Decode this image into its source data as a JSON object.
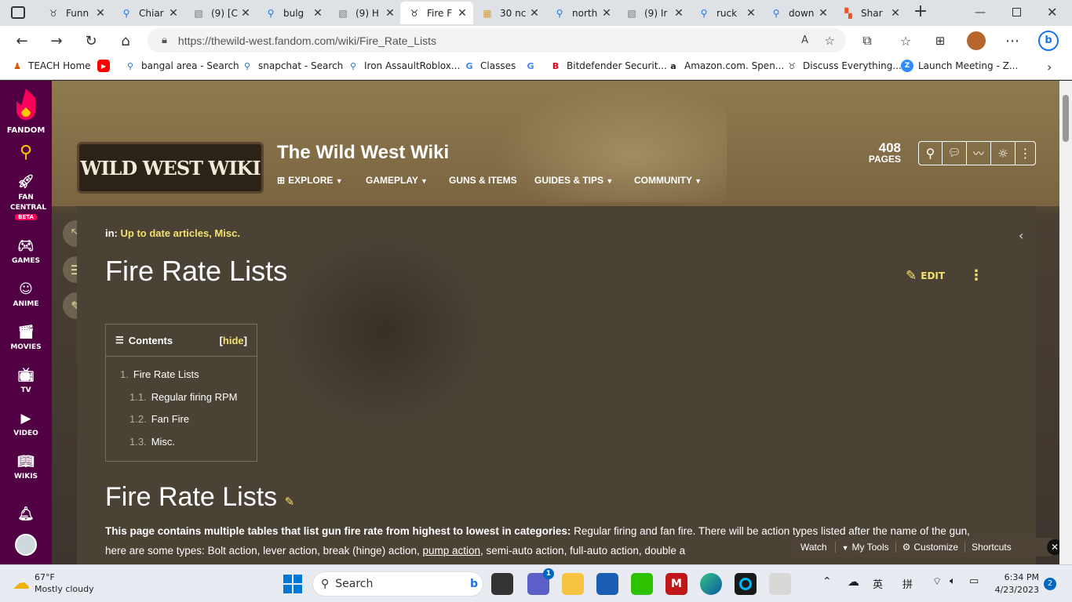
{
  "tabs": [
    {
      "title": "Funn",
      "icon": "bull-icon"
    },
    {
      "title": "Chiar",
      "icon": "search-icon"
    },
    {
      "title": "(9) [C",
      "icon": "roblox-icon"
    },
    {
      "title": "bulg",
      "icon": "search-icon"
    },
    {
      "title": "(9) H",
      "icon": "roblox-icon"
    },
    {
      "title": "Fire F",
      "icon": "bull-icon"
    },
    {
      "title": "30 nc",
      "icon": "tiles-icon"
    },
    {
      "title": "north",
      "icon": "search-icon"
    },
    {
      "title": "(9) Ir",
      "icon": "roblox-icon"
    },
    {
      "title": "ruck",
      "icon": "search-icon"
    },
    {
      "title": "down",
      "icon": "search-icon"
    },
    {
      "title": "Shar",
      "icon": "microsoft-icon"
    }
  ],
  "address": {
    "url": "https://thewild-west.fandom.com/wiki/Fire_Rate_Lists"
  },
  "bookmarks": [
    {
      "label": "TEACH Home",
      "icon": "teach-icon"
    },
    {
      "label": "",
      "icon": "youtube-icon"
    },
    {
      "label": "bangal area - Search",
      "icon": "search-icon"
    },
    {
      "label": "snapchat - Search",
      "icon": "search-icon"
    },
    {
      "label": "Iron AssaultRoblox...",
      "icon": "search-icon"
    },
    {
      "label": "Classes",
      "icon": "google-icon"
    },
    {
      "label": "",
      "icon": "google-icon"
    },
    {
      "label": "Bitdefender Securit...",
      "icon": "bitdefender-icon"
    },
    {
      "label": "Amazon.com. Spen...",
      "icon": "amazon-icon"
    },
    {
      "label": "Discuss Everything...",
      "icon": "bull-icon"
    },
    {
      "label": "Launch Meeting - Z...",
      "icon": "zoom-icon"
    }
  ],
  "rail": {
    "brand": "FANDOM",
    "fan_central": "FAN CENTRAL",
    "beta": "BETA",
    "games": "GAMES",
    "anime": "ANIME",
    "movies": "MOVIES",
    "tv": "TV",
    "video": "VIDEO",
    "wikis": "WIKIS"
  },
  "wiki": {
    "logo_text": "WILD WEST WIKI",
    "title": "The Wild West Wiki",
    "page_count": "408",
    "pages_label": "PAGES",
    "nav": [
      "EXPLORE",
      "GAMEPLAY",
      "GUNS & ITEMS",
      "GUIDES & TIPS",
      "COMMUNITY"
    ]
  },
  "article": {
    "categories_label": "in:",
    "categories": "Up to date articles, Misc.",
    "title": "Fire Rate Lists",
    "edit_label": "EDIT",
    "toc_title": "Contents",
    "toc_hide": "hide",
    "toc": [
      {
        "num": "1.",
        "label": "Fire Rate Lists"
      },
      {
        "num": "1.1.",
        "label": "Regular firing RPM"
      },
      {
        "num": "1.2.",
        "label": "Fan Fire"
      },
      {
        "num": "1.3.",
        "label": "Misc."
      }
    ],
    "section_title": "Fire Rate Lists",
    "body_bold": "This page contains multiple tables that list gun fire rate from highest to lowest in categories:",
    "body_1": " Regular firing and fan fire. There will be action types listed after the name of the gun, here are some types: Bolt action, lever action, break (hinge) action, ",
    "body_link": "pump action",
    "body_2": ", semi-auto action, full-auto action, double a"
  },
  "toolbar": {
    "watch": "Watch",
    "my_tools": "My Tools",
    "customize": "Customize",
    "shortcuts": "Shortcuts"
  },
  "taskbar": {
    "temp": "67°F",
    "weather": "Mostly cloudy",
    "search": "Search",
    "lang": "英",
    "ime": "拼",
    "time": "6:34 PM",
    "date": "4/23/2023",
    "notif": "2",
    "teams_badge": "1"
  },
  "colors": {
    "fandom_rail": "#520044",
    "accent_yellow": "#f3e06f",
    "article_bg": "#4b4236"
  }
}
